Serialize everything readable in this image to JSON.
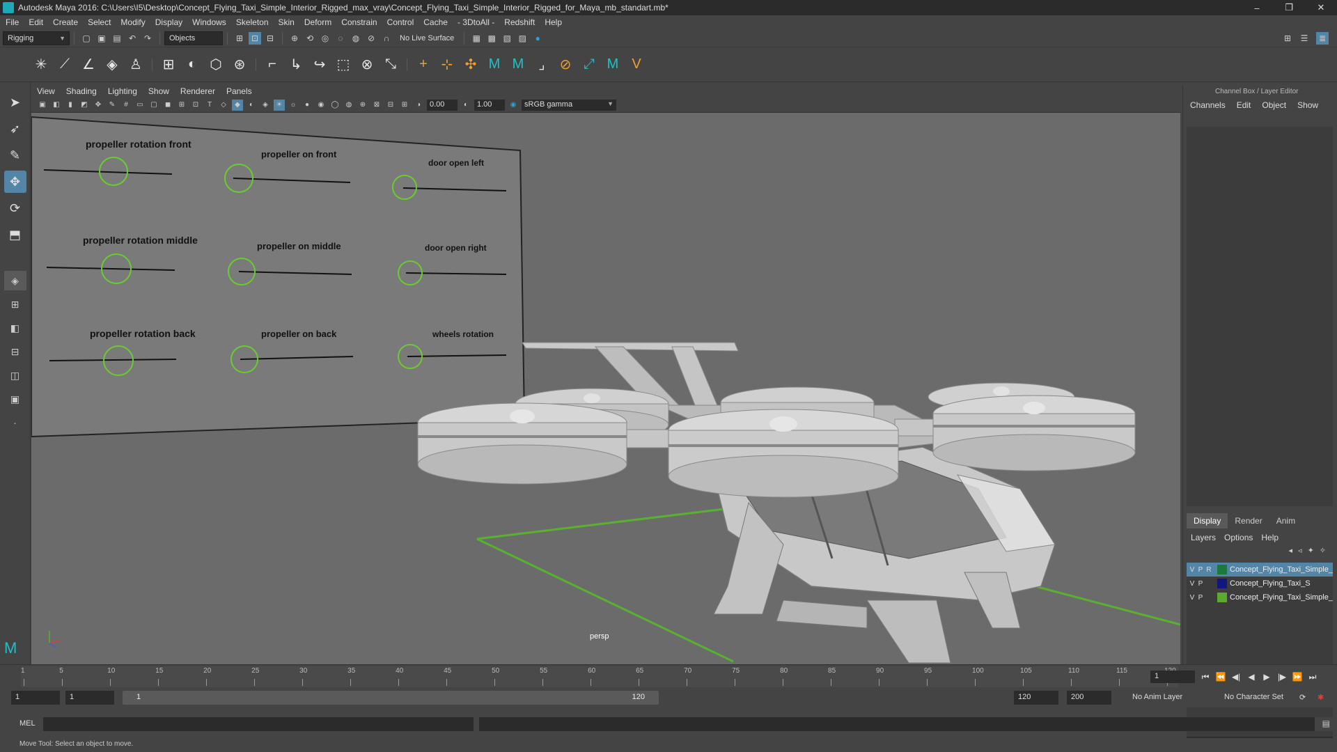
{
  "window": {
    "title": "Autodesk Maya 2016: C:\\Users\\I5\\Desktop\\Concept_Flying_Taxi_Simple_Interior_Rigged_max_vray\\Concept_Flying_Taxi_Simple_Interior_Rigged_for_Maya_mb_standart.mb*",
    "minimize": "–",
    "maximize": "❐",
    "close": "✕"
  },
  "menubar": [
    "File",
    "Edit",
    "Create",
    "Select",
    "Modify",
    "Display",
    "Windows",
    "Skeleton",
    "Skin",
    "Deform",
    "Constrain",
    "Control",
    "Cache",
    "- 3DtoAll -",
    "Redshift",
    "Help"
  ],
  "statusline": {
    "menuset": "Rigging",
    "selection_mode": "Objects",
    "live_surface": "No Live Surface"
  },
  "panel": {
    "menus": [
      "View",
      "Shading",
      "Lighting",
      "Show",
      "Renderer",
      "Panels"
    ],
    "near_value": "0.00",
    "far_value": "1.00",
    "color_space": "sRGB gamma",
    "camera": "persp"
  },
  "rig_controls": {
    "propeller_rotation_front": "propeller rotation front",
    "propeller_on_front": "propeller on front",
    "door_open_left": "door open left",
    "propeller_rotation_middle": "propeller rotation middle",
    "propeller_on_middle": "propeller on middle",
    "door_open_right": "door open right",
    "propeller_rotation_back": "propeller rotation back",
    "propeller_on_back": "propeller on back",
    "wheels_rotation": "wheels rotation"
  },
  "channelbox": {
    "title": "Channel Box / Layer Editor",
    "tabs": [
      "Channels",
      "Edit",
      "Object",
      "Show"
    ],
    "layer_tabs": [
      "Display",
      "Render",
      "Anim"
    ],
    "layer_menus": [
      "Layers",
      "Options",
      "Help"
    ],
    "layers": [
      {
        "v": "V",
        "p": "P",
        "r": "R",
        "name": "Concept_Flying_Taxi_Simple_",
        "color": "#1a7a3a"
      },
      {
        "v": "V",
        "p": "P",
        "r": "",
        "name": "Concept_Flying_Taxi_S",
        "color": "#101880"
      },
      {
        "v": "V",
        "p": "P",
        "r": "",
        "name": "Concept_Flying_Taxi_Simple_",
        "color": "#5aaa30"
      }
    ]
  },
  "timeline": {
    "ticks": [
      "1",
      "5",
      "10",
      "15",
      "20",
      "25",
      "30",
      "35",
      "40",
      "45",
      "50",
      "55",
      "60",
      "65",
      "70",
      "75",
      "80",
      "85",
      "90",
      "95",
      "100",
      "105",
      "110",
      "115",
      "120"
    ],
    "current_frame": "1"
  },
  "range": {
    "start": "1",
    "anim_start": "1",
    "bar_start": "1",
    "bar_end": "120",
    "end": "120",
    "anim_end": "200",
    "anim_layer": "No Anim Layer",
    "character_set": "No Character Set"
  },
  "command": {
    "label": "MEL"
  },
  "help_line": "Move Tool: Select an object to move."
}
